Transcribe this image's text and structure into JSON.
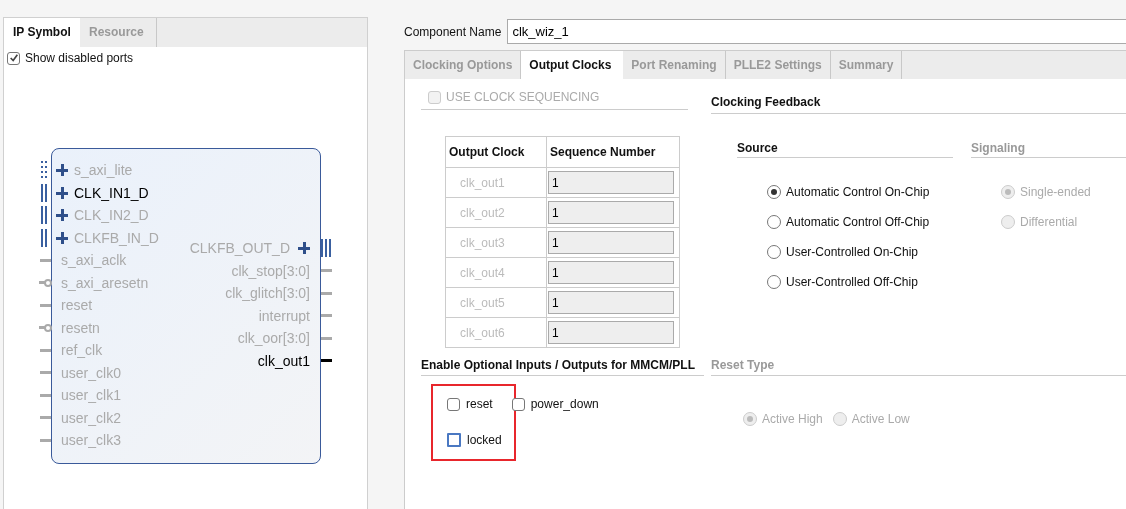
{
  "symbol_panel": {
    "tabs": [
      {
        "label": "IP Symbol",
        "selected": true
      },
      {
        "label": "Resource",
        "selected": false
      }
    ],
    "show_disabled_ports": {
      "label": "Show disabled ports",
      "checked": true
    },
    "left_ports": [
      {
        "name": "s_axi_lite",
        "kind": "bus_optional",
        "active": false
      },
      {
        "name": "CLK_IN1_D",
        "kind": "bus",
        "active": true
      },
      {
        "name": "CLK_IN2_D",
        "kind": "bus",
        "active": false
      },
      {
        "name": "CLKFB_IN_D",
        "kind": "bus",
        "active": false
      },
      {
        "name": "s_axi_aclk",
        "kind": "wire",
        "active": false
      },
      {
        "name": "s_axi_aresetn",
        "kind": "inverted",
        "active": false
      },
      {
        "name": "reset",
        "kind": "wire",
        "active": false
      },
      {
        "name": "resetn",
        "kind": "inverted",
        "active": false
      },
      {
        "name": "ref_clk",
        "kind": "wire",
        "active": false
      },
      {
        "name": "user_clk0",
        "kind": "wire",
        "active": false
      },
      {
        "name": "user_clk1",
        "kind": "wire",
        "active": false
      },
      {
        "name": "user_clk2",
        "kind": "wire",
        "active": false
      },
      {
        "name": "user_clk3",
        "kind": "wire",
        "active": false
      }
    ],
    "right_ports": [
      {
        "name": "CLKFB_OUT_D",
        "kind": "bus",
        "active": false
      },
      {
        "name": "clk_stop[3:0]",
        "kind": "wire",
        "active": false
      },
      {
        "name": "clk_glitch[3:0]",
        "kind": "wire",
        "active": false
      },
      {
        "name": "interrupt",
        "kind": "wire",
        "active": false
      },
      {
        "name": "clk_oor[3:0]",
        "kind": "wire",
        "active": false
      },
      {
        "name": "clk_out1",
        "kind": "wire",
        "active": true
      }
    ]
  },
  "component_name": {
    "label": "Component Name",
    "value": "clk_wiz_1"
  },
  "tabs": [
    {
      "label": "Clocking Options",
      "selected": false
    },
    {
      "label": "Output Clocks",
      "selected": true
    },
    {
      "label": "Port Renaming",
      "selected": false
    },
    {
      "label": "PLLE2 Settings",
      "selected": false
    },
    {
      "label": "Summary",
      "selected": false
    }
  ],
  "use_clock_sequencing": {
    "label": "USE CLOCK SEQUENCING",
    "checked": false,
    "disabled": true
  },
  "sequence_table": {
    "columns": [
      "Output Clock",
      "Sequence Number"
    ],
    "rows": [
      {
        "clock": "clk_out1",
        "sequence": "1"
      },
      {
        "clock": "clk_out2",
        "sequence": "1"
      },
      {
        "clock": "clk_out3",
        "sequence": "1"
      },
      {
        "clock": "clk_out4",
        "sequence": "1"
      },
      {
        "clock": "clk_out5",
        "sequence": "1"
      },
      {
        "clock": "clk_out6",
        "sequence": "1"
      }
    ]
  },
  "clocking_feedback": {
    "title": "Clocking Feedback",
    "source": {
      "title": "Source",
      "options": [
        {
          "label": "Automatic Control On-Chip",
          "selected": true
        },
        {
          "label": "Automatic Control Off-Chip",
          "selected": false
        },
        {
          "label": "User-Controlled On-Chip",
          "selected": false
        },
        {
          "label": "User-Controlled Off-Chip",
          "selected": false
        }
      ]
    },
    "signaling": {
      "title": "Signaling",
      "disabled": true,
      "options": [
        {
          "label": "Single-ended",
          "selected": true
        },
        {
          "label": "Differential",
          "selected": false
        }
      ]
    }
  },
  "optional_io": {
    "title": "Enable Optional Inputs / Outputs for MMCM/PLL",
    "columns": [
      {
        "highlighted": true,
        "items": [
          {
            "label": "reset",
            "checked": false,
            "focused": false
          },
          {
            "label": "locked",
            "checked": false,
            "focused": true
          }
        ]
      },
      {
        "highlighted": false,
        "items": [
          {
            "label": "power_down",
            "checked": false,
            "focused": false
          }
        ]
      }
    ]
  },
  "reset_type": {
    "title": "Reset Type",
    "disabled": true,
    "options": [
      {
        "label": "Active High",
        "selected": true
      },
      {
        "label": "Active Low",
        "selected": false
      }
    ]
  }
}
